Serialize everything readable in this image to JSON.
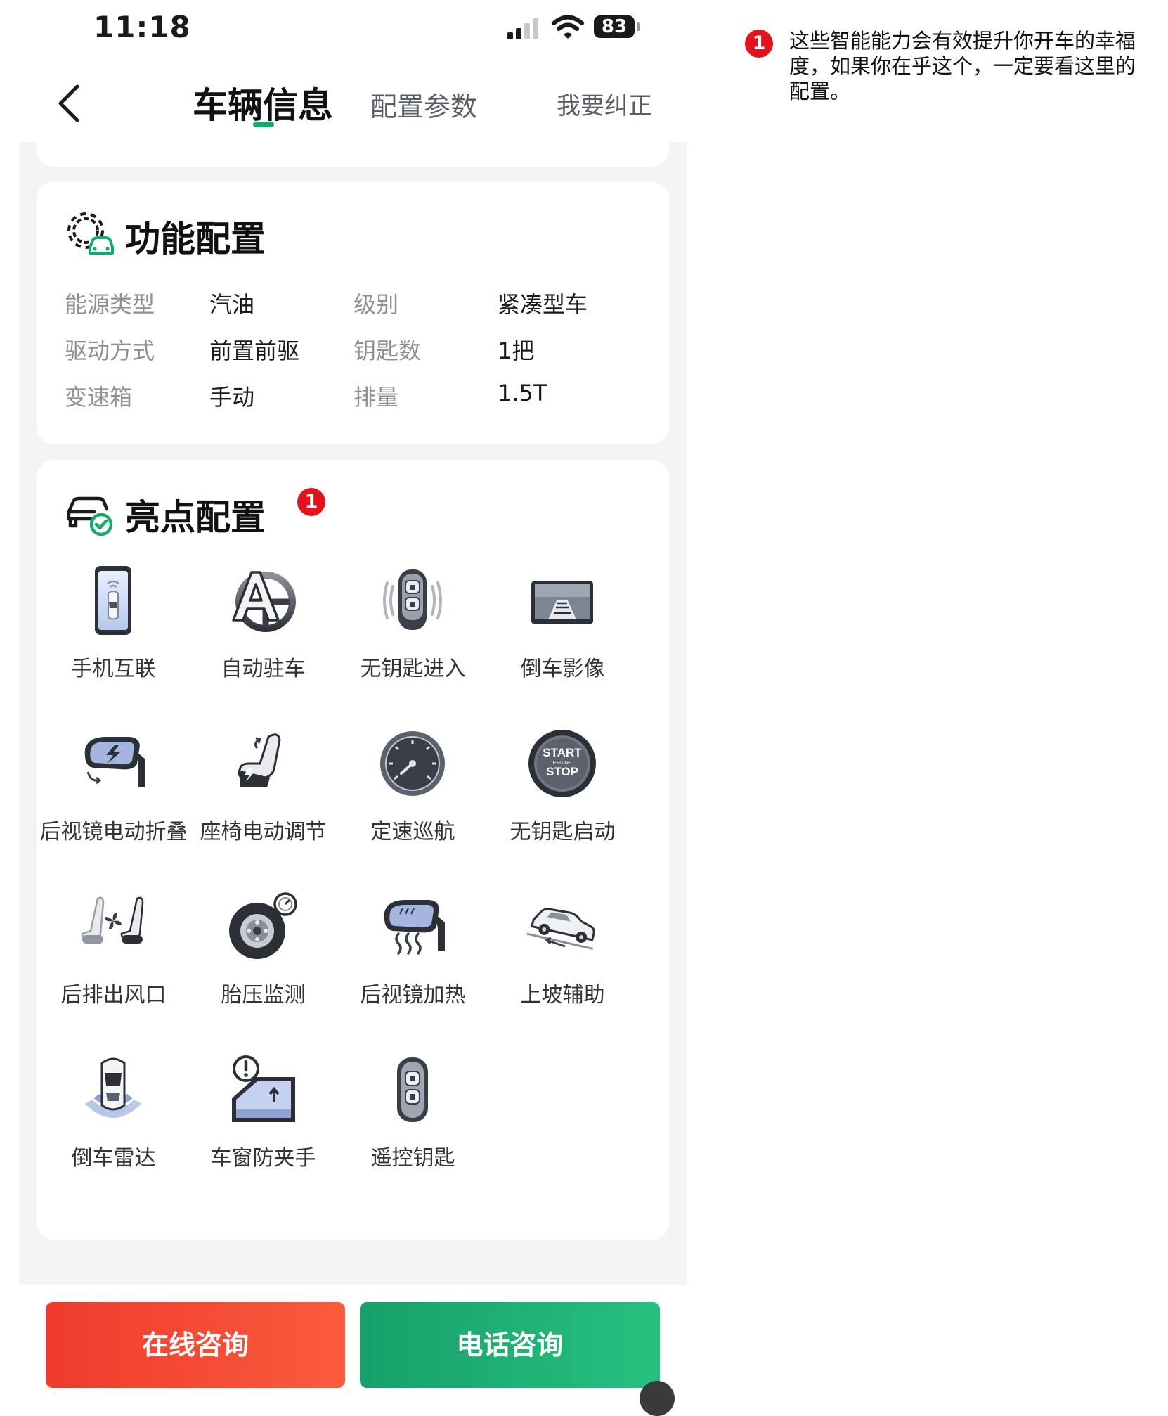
{
  "status_bar": {
    "time": "11:18",
    "battery": "83"
  },
  "nav": {
    "active_tab": "车辆信息",
    "tab2": "配置参数",
    "correct_link": "我要纠正"
  },
  "function_config": {
    "title": "功能配置",
    "rows": [
      [
        {
          "label": "能源类型",
          "value": "汽油"
        },
        {
          "label": "级别",
          "value": "紧凑型车"
        }
      ],
      [
        {
          "label": "驱动方式",
          "value": "前置前驱"
        },
        {
          "label": "钥匙数",
          "value": "1把"
        }
      ],
      [
        {
          "label": "变速箱",
          "value": "手动"
        },
        {
          "label": "排量",
          "value": "1.5T"
        }
      ]
    ]
  },
  "highlight_config": {
    "title": "亮点配置",
    "badge": "1",
    "features": [
      {
        "label": "手机互联",
        "icon": "phone-link-icon"
      },
      {
        "label": "自动驻车",
        "icon": "auto-hold-icon"
      },
      {
        "label": "无钥匙进入",
        "icon": "keyless-entry-icon"
      },
      {
        "label": "倒车影像",
        "icon": "reverse-camera-icon"
      },
      {
        "label": "后视镜电动折叠",
        "icon": "mirror-fold-icon"
      },
      {
        "label": "座椅电动调节",
        "icon": "power-seat-icon"
      },
      {
        "label": "定速巡航",
        "icon": "cruise-control-icon"
      },
      {
        "label": "无钥匙启动",
        "icon": "start-stop-icon"
      },
      {
        "label": "后排出风口",
        "icon": "rear-vent-icon"
      },
      {
        "label": "胎压监测",
        "icon": "tire-pressure-icon"
      },
      {
        "label": "后视镜加热",
        "icon": "mirror-heat-icon"
      },
      {
        "label": "上坡辅助",
        "icon": "hill-assist-icon"
      },
      {
        "label": "倒车雷达",
        "icon": "parking-radar-icon"
      },
      {
        "label": "车窗防夹手",
        "icon": "anti-pinch-icon"
      },
      {
        "label": "遥控钥匙",
        "icon": "remote-key-icon"
      }
    ],
    "start_button_text": [
      "START",
      "ENGINE",
      "STOP"
    ]
  },
  "actions": {
    "online_consult": "在线咨询",
    "phone_consult": "电话咨询"
  },
  "annotation": {
    "badge": "1",
    "text": "这些智能能力会有效提升你开车的幸福度，如果你在乎这个，一定要看这里的配置。"
  },
  "colors": {
    "accent_green": "#17a86b",
    "cta_red": "#f3452f",
    "cta_green": "#1fb074",
    "badge_red": "#e3131e"
  }
}
